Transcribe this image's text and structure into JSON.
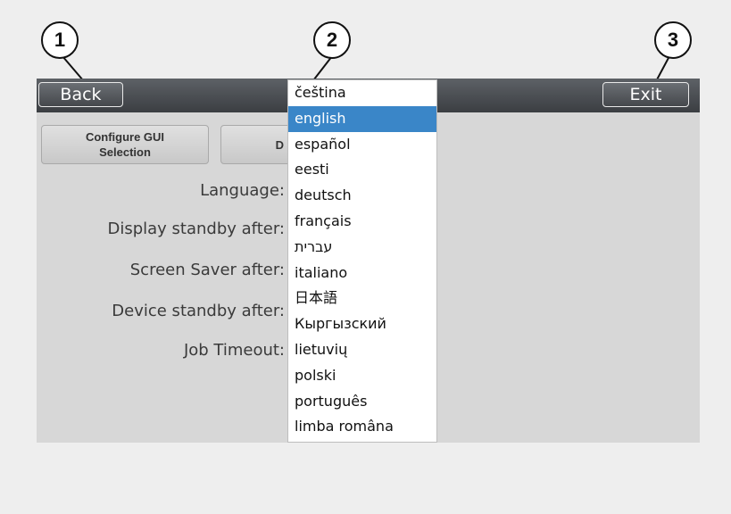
{
  "topbar": {
    "back_label": "Back",
    "exit_label": "Exit"
  },
  "tabs": [
    {
      "label": "Configure GUI\nSelection"
    },
    {
      "label": "D"
    }
  ],
  "settings": [
    {
      "label": "Language:"
    },
    {
      "label": "Display standby after:"
    },
    {
      "label": "Screen Saver after:"
    },
    {
      "label": "Device standby after:"
    },
    {
      "label": "Job Timeout:"
    }
  ],
  "language_dropdown": {
    "selected": "english",
    "options": [
      "čeština",
      "english",
      "español",
      "eesti",
      "deutsch",
      "français",
      "עברית",
      "italiano",
      "日本語",
      "Кыргызский",
      "lietuvių",
      "polski",
      "português",
      "limba româna"
    ]
  },
  "callouts": [
    {
      "number": "1"
    },
    {
      "number": "2"
    },
    {
      "number": "3"
    }
  ],
  "colors": {
    "selection": "#3a86c8",
    "topbar": "#3b3e42",
    "panel": "#d7d7d7"
  }
}
